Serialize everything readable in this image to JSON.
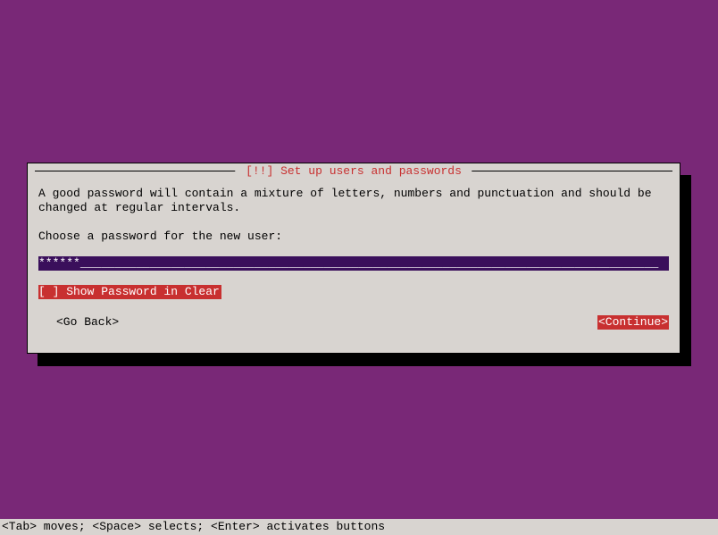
{
  "dialog": {
    "title": " [!!] Set up users and passwords ",
    "description": "A good password will contain a mixture of letters, numbers and punctuation and should be changed at regular intervals.",
    "prompt": "Choose a password for the new user:",
    "password_value": "******",
    "checkbox_label": "[ ] Show Password in Clear",
    "go_back_label": "<Go Back>",
    "continue_label": "<Continue>"
  },
  "statusbar": "<Tab> moves; <Space> selects; <Enter> activates buttons"
}
